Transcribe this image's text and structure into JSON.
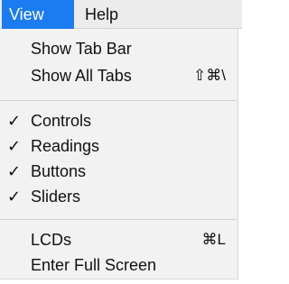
{
  "menubar": {
    "view_label": "View",
    "help_label": "Help"
  },
  "menu": {
    "show_tab_bar": "Show Tab Bar",
    "show_all_tabs": "Show All Tabs",
    "show_all_tabs_shortcut": "⇧⌘\\",
    "check_glyph": "✓",
    "controls": "Controls",
    "readings": "Readings",
    "buttons": "Buttons",
    "sliders": "Sliders",
    "lcds": "LCDs",
    "lcds_shortcut": "⌘L",
    "enter_full_screen": "Enter Full Screen"
  },
  "colors": {
    "accent": "#1a7cf0",
    "menu_background": "#f2f2f2",
    "menubar_background": "#ececec"
  }
}
